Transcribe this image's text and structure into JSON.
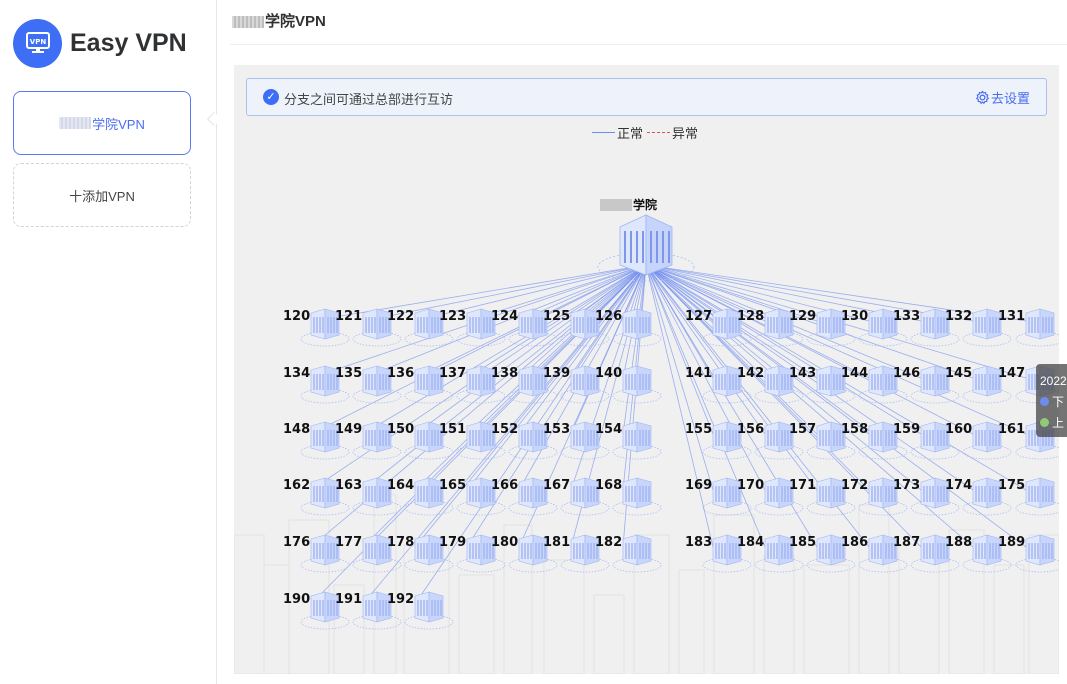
{
  "brand": {
    "name": "Easy VPN",
    "logo_text": "VPN",
    "color": "#3d6ef5"
  },
  "sidebar": {
    "active_vpn": {
      "label": "学院VPN"
    },
    "add_vpn": {
      "label": "十添加VPN"
    }
  },
  "header": {
    "title": "学院VPN"
  },
  "notice": {
    "text": "分支之间可通过总部进行互访",
    "link": "去设置"
  },
  "legend": {
    "normal": "正常",
    "abnormal": "异常",
    "normal_color": "#6d8bf0",
    "abnormal_color": "#e05050"
  },
  "topology": {
    "hq": {
      "label": "学院"
    },
    "left_rows": [
      [
        "120",
        "121",
        "122",
        "123",
        "124",
        "125",
        "126"
      ],
      [
        "134",
        "135",
        "136",
        "137",
        "138",
        "139",
        "140"
      ],
      [
        "148",
        "149",
        "150",
        "151",
        "152",
        "153",
        "154"
      ],
      [
        "162",
        "163",
        "164",
        "165",
        "166",
        "167",
        "168"
      ],
      [
        "176",
        "177",
        "178",
        "179",
        "180",
        "181",
        "182"
      ],
      [
        "190",
        "191",
        "192"
      ]
    ],
    "right_rows": [
      [
        "127",
        "128",
        "129",
        "130",
        "133",
        "132",
        "131"
      ],
      [
        "141",
        "142",
        "143",
        "144",
        "146",
        "145",
        "147"
      ],
      [
        "155",
        "156",
        "157",
        "158",
        "159",
        "160",
        "161"
      ],
      [
        "169",
        "170",
        "171",
        "172",
        "173",
        "174",
        "175"
      ],
      [
        "183",
        "184",
        "185",
        "186",
        "187",
        "188",
        "189"
      ]
    ]
  },
  "tooltip": {
    "title": "2022",
    "rows": [
      {
        "label": "下",
        "color": "#6d8bf0"
      },
      {
        "label": "上",
        "color": "#91cc75"
      }
    ]
  }
}
